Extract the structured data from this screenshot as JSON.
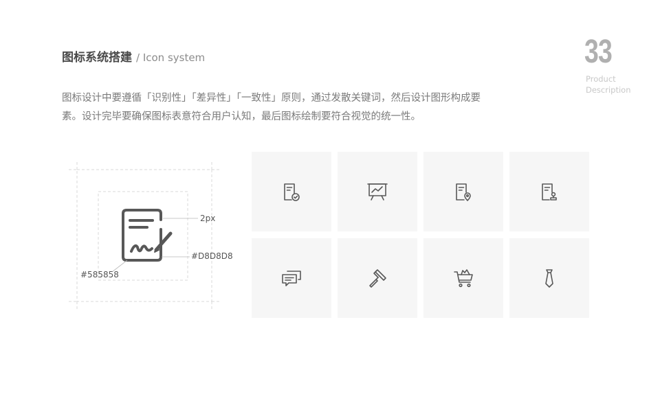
{
  "header": {
    "title": "图标系统搭建",
    "subtitle": "/ Icon system",
    "page_number": "33",
    "page_label_line1": "Product",
    "page_label_line2": "Description"
  },
  "description": {
    "line1": "图标设计中要遵循「识别性」「差异性」「一致性」原则，通过发散关键词，然后设计图形构成要",
    "line2": "素。设计完毕要确保图标表意符合用户认知，最后图标绘制要符合视觉的统一性。"
  },
  "spec": {
    "stroke_label": "2px",
    "guide_color_label": "#D8D8D8",
    "icon_color_label": "#585858",
    "icon_color": "#585858",
    "guide_color": "#D8D8D8"
  },
  "icons": [
    {
      "icon": "document-check-icon"
    },
    {
      "icon": "presentation-chart-icon"
    },
    {
      "icon": "document-location-icon"
    },
    {
      "icon": "document-seal-icon"
    },
    {
      "icon": "chat-bubbles-icon"
    },
    {
      "icon": "paint-roller-icon"
    },
    {
      "icon": "shopping-cart-icon"
    },
    {
      "icon": "necktie-icon"
    }
  ]
}
